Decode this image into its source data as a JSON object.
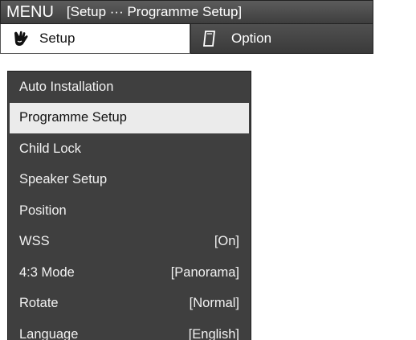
{
  "header": {
    "menu_label": "MENU",
    "breadcrumb": "[Setup ··· Programme Setup]"
  },
  "tabs": [
    {
      "label": "Setup",
      "icon": "hand-icon",
      "active": true
    },
    {
      "label": "Option",
      "icon": "remote-card-icon",
      "active": false
    }
  ],
  "menu": {
    "items": [
      {
        "label": "Auto Installation",
        "value": ""
      },
      {
        "label": "Programme Setup",
        "value": "",
        "selected": true
      },
      {
        "label": "Child Lock",
        "value": ""
      },
      {
        "label": "Speaker Setup",
        "value": ""
      },
      {
        "label": "Position",
        "value": ""
      },
      {
        "label": "WSS",
        "value": "[On]"
      },
      {
        "label": "4:3 Mode",
        "value": "[Panorama]"
      },
      {
        "label": "Rotate",
        "value": "[Normal]"
      },
      {
        "label": "Language",
        "value": "[English]"
      }
    ]
  },
  "colors": {
    "bar_dark": "#4a4a4a",
    "menu_bg": "#3f3f3f",
    "selected_bg": "#ebebeb",
    "text_light": "#f2f2f2",
    "text_dark": "#111111"
  }
}
